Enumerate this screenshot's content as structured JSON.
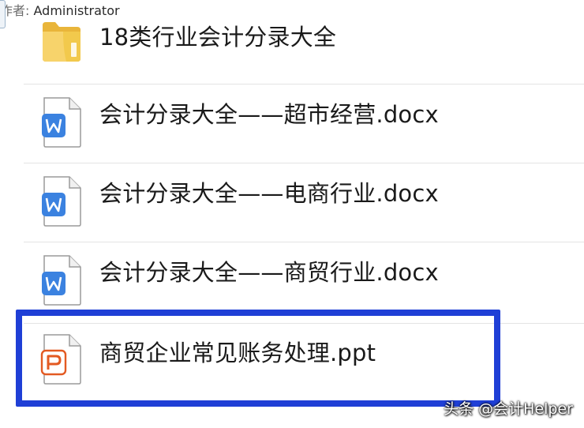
{
  "files": [
    {
      "name": "18类行业会计分录大全",
      "type": "folder",
      "icon": "folder-icon"
    },
    {
      "name": "会计分录大全——超市经营.docx",
      "type": "docx",
      "icon": "wps-writer-icon"
    },
    {
      "name": "会计分录大全——电商行业.docx",
      "type": "docx",
      "icon": "wps-writer-icon"
    },
    {
      "name": "会计分录大全——商贸行业.docx",
      "type": "docx",
      "icon": "wps-writer-icon"
    },
    {
      "name": "商贸企业常见账务处理.ppt",
      "type": "ppt",
      "icon": "wps-presentation-icon",
      "author_label": "作者:",
      "author": "Administrator",
      "selected": true
    }
  ],
  "colors": {
    "highlight": "#1f3fd6",
    "word_blue": "#3b82e0",
    "ppt_orange": "#e35a22",
    "folder_yellow": "#f2c94c"
  },
  "watermark": "头条 @会计Helper"
}
